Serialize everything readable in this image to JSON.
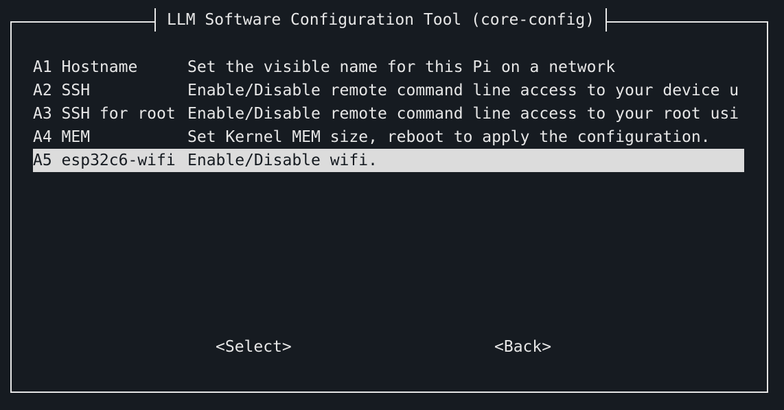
{
  "window": {
    "title": "LLM Software Configuration Tool (core-config)"
  },
  "menu": {
    "items": [
      {
        "tag": "A1 Hostname",
        "desc": "Set the visible name for this Pi on a network",
        "selected": false
      },
      {
        "tag": "A2 SSH",
        "desc": "Enable/Disable remote command line access to your device u",
        "selected": false
      },
      {
        "tag": "A3 SSH for root",
        "desc": "Enable/Disable remote command line access to your root usi",
        "selected": false
      },
      {
        "tag": "A4 MEM",
        "desc": "Set Kernel MEM size, reboot to apply the configuration.",
        "selected": false
      },
      {
        "tag": "A5 esp32c6-wifi",
        "desc": "Enable/Disable wifi.",
        "selected": true
      }
    ]
  },
  "buttons": {
    "select_label": "<Select>",
    "back_label": "<Back>"
  },
  "colors": {
    "background": "#161b21",
    "foreground": "#e6e6e6",
    "highlight": "#dcdcdc"
  }
}
